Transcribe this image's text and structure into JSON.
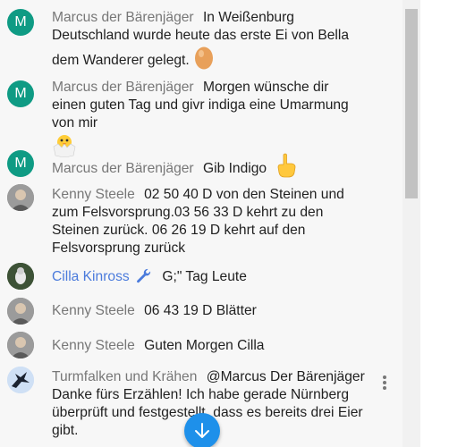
{
  "messages": [
    {
      "author": "Marcus der Bärenjäger",
      "avatar_letter": "M",
      "text": "In Weißenburg Deutschland wurde heute das erste Ei von Bella dem Wanderer gelegt.",
      "emoji": "egg-icon"
    },
    {
      "author": "Marcus der Bärenjäger",
      "avatar_letter": "M",
      "text": "Morgen wünsche dir einen guten Tag und givr indiga eine Umarmung von mir",
      "emoji": "hatching-chick-icon"
    },
    {
      "author": "Marcus der Bärenjäger",
      "avatar_letter": "M",
      "text": "Gib Indigo",
      "emoji": "pointing-hand-icon"
    },
    {
      "author": "Kenny Steele",
      "text": "02 50 40 D von den Steinen und zum Felsvorsprung.03 56 33 D kehrt zu den Steinen zurück. 06 26 19 D kehrt auf den Felsvorsprung zurück"
    },
    {
      "author": "Cilla Kinross",
      "badge": "wrench-icon",
      "text": "G;\" Tag Leute"
    },
    {
      "author": "Kenny Steele",
      "text": "06 43 19 D Blätter"
    },
    {
      "author": "Kenny Steele",
      "text": "Guten Morgen Cilla"
    },
    {
      "author": "Turmfalken und Krähen",
      "text": "@Marcus Der Bärenjäger Danke fürs Erzählen! Ich habe gerade Nürnberg überprüft und festgestellt, dass es bereits drei Eier gibt."
    }
  ],
  "colors": {
    "accent": "#1e90ea",
    "moderator_name": "#4b7bdc",
    "avatar_green": "#0f9b84"
  }
}
